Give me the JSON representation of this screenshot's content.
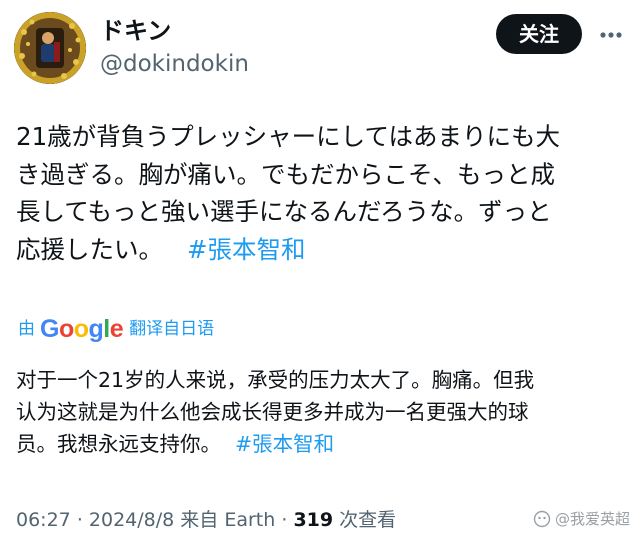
{
  "author": {
    "display_name": "ドキン",
    "handle": "@dokindokin",
    "avatar_icon": "profile-photo"
  },
  "header": {
    "follow_label": "关注",
    "more_icon": "ellipsis-icon"
  },
  "tweet": {
    "lines": [
      "21歳が背負うプレッシャーにしてはあまりにも大",
      "き過ぎる。胸が痛い。でもだからこそ、もっと成",
      "長してもっと強い選手になるんだろうな。ずっと",
      "応援したい。"
    ],
    "hashtag": "#張本智和"
  },
  "translation": {
    "prefix": "由",
    "provider": "Google",
    "suffix": "翻译自日语",
    "lines": [
      "对于一个21岁的人来说，承受的压力太大了。胸痛。但我",
      "认为这就是为什么他会成长得更多并成为一名更强大的球",
      "员。我想永远支持你。"
    ],
    "hashtag": "#張本智和"
  },
  "meta": {
    "time": "06:27",
    "date": "2024/8/8",
    "source": "来自 Earth",
    "separator": "·",
    "views": "319",
    "views_label": "次查看"
  },
  "watermark": {
    "text": "@我爱英超"
  },
  "colors": {
    "accent": "#1d9bf0",
    "text": "#0f1419",
    "muted": "#536471",
    "button_bg": "#0f1419"
  }
}
